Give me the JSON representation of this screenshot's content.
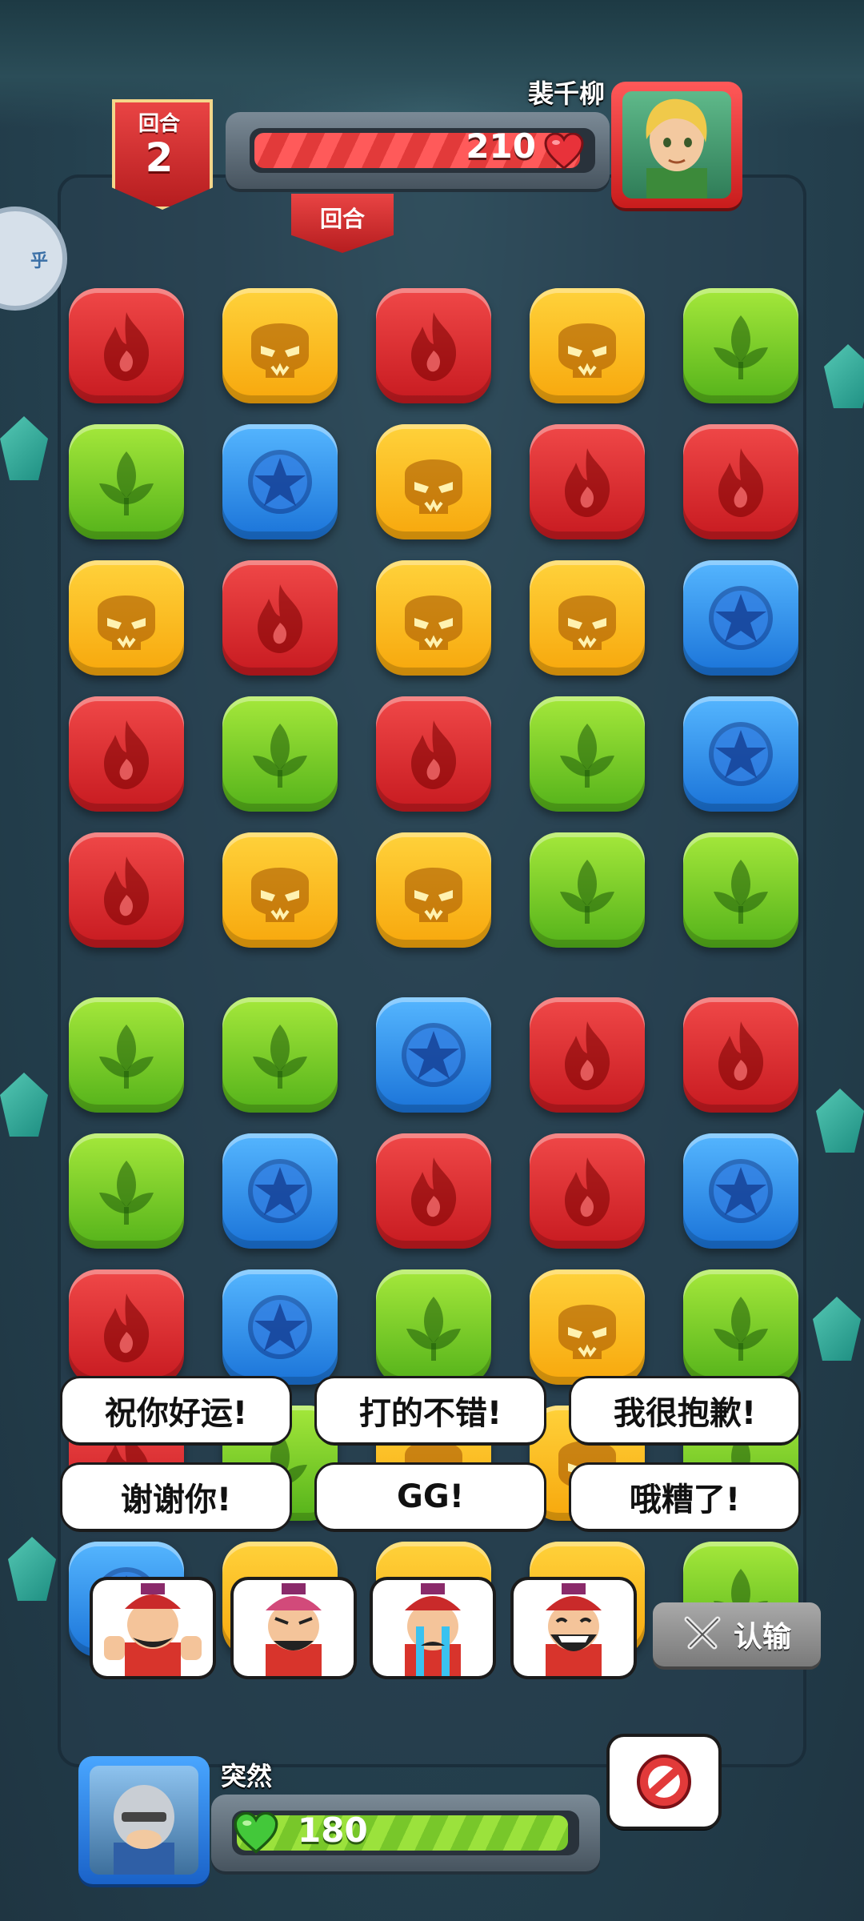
{
  "opponent": {
    "name": "裴千柳",
    "hp": "210",
    "hp_fraction": 0.97
  },
  "round": {
    "label": "回合",
    "number": "2",
    "tab_label": "回合"
  },
  "side_badge": {
    "glyph": "乎"
  },
  "player": {
    "name": "突然",
    "hp": "180",
    "hp_fraction": 0.98
  },
  "board": {
    "rows": [
      [
        "fire",
        "skull",
        "fire",
        "skull",
        "leaf"
      ],
      [
        "leaf",
        "star",
        "skull",
        "fire",
        "fire"
      ],
      [
        "skull",
        "fire",
        "skull",
        "skull",
        "star"
      ],
      [
        "fire",
        "leaf",
        "fire",
        "leaf",
        "star"
      ],
      [
        "fire",
        "skull",
        "skull",
        "leaf",
        "leaf"
      ],
      [
        "leaf",
        "leaf",
        "star",
        "fire",
        "fire"
      ],
      [
        "leaf",
        "star",
        "fire",
        "fire",
        "star"
      ],
      [
        "fire",
        "star",
        "leaf",
        "skull",
        "leaf"
      ],
      [
        "fire",
        "leaf",
        "skull",
        "skull",
        "leaf"
      ],
      [
        "star",
        "skull",
        "skull",
        "skull",
        "leaf"
      ]
    ],
    "colors": {
      "fire": "#e02a2f",
      "skull": "#fbb81a",
      "leaf": "#7cd02a",
      "star": "#2f8ef0"
    },
    "icons": {
      "fire": "flame-icon",
      "skull": "skull-icon",
      "leaf": "leaf-icon",
      "star": "star-icon"
    }
  },
  "chat": {
    "phrases": [
      "祝你好运!",
      "打的不错!",
      "我很抱歉!",
      "谢谢你!",
      "GG!",
      "哦糟了!"
    ],
    "emotes": [
      "thumbs-up-king-emote",
      "angry-king-emote",
      "crying-king-emote",
      "laughing-king-emote"
    ],
    "surrender_label": "认输"
  },
  "icons": {
    "hp_heart": "heart-icon",
    "player_heart": "green-heart-icon",
    "mute": "no-entry-icon",
    "surrender": "crossed-swords-icon"
  }
}
